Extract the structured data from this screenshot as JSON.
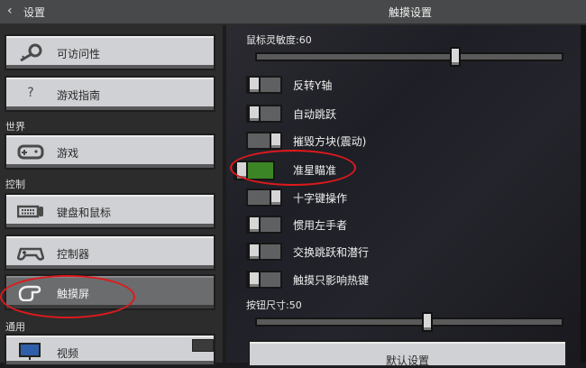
{
  "header": {
    "back_label": "设置",
    "title": "触摸设置"
  },
  "sidebar": {
    "items": [
      {
        "label": "可访问性",
        "icon": "key-icon"
      },
      {
        "label": "游戏指南",
        "icon": "question-icon"
      },
      {
        "label": "游戏",
        "icon": "gamepad-icon"
      },
      {
        "label": "键盘和鼠标",
        "icon": "keyboard-icon"
      },
      {
        "label": "控制器",
        "icon": "controller-icon"
      },
      {
        "label": "触摸屏",
        "icon": "touch-icon"
      },
      {
        "label": "视频",
        "icon": "monitor-icon"
      }
    ],
    "sections": {
      "world": "世界",
      "controls": "控制",
      "general": "通用"
    },
    "question_mark": "?"
  },
  "settings": {
    "mouse_sensitivity_label": "鼠标灵敏度:60",
    "mouse_sensitivity_value": 60,
    "button_size_label": "按钮尺寸:50",
    "button_size_value": 50,
    "toggles": [
      {
        "label": "反转Y轴",
        "on": false
      },
      {
        "label": "自动跳跃",
        "on": false
      },
      {
        "label": "摧毁方块(震动)",
        "on": false
      },
      {
        "label": "准星瞄准",
        "on": true
      },
      {
        "label": "十字键操作",
        "on": false
      },
      {
        "label": "惯用左手者",
        "on": false
      },
      {
        "label": "交换跳跃和潜行",
        "on": false
      },
      {
        "label": "触摸只影响热键",
        "on": false
      }
    ],
    "reset_label": "默认设置"
  },
  "colors": {
    "accent_on": "#3c8527",
    "annotation": "#e0191c"
  }
}
